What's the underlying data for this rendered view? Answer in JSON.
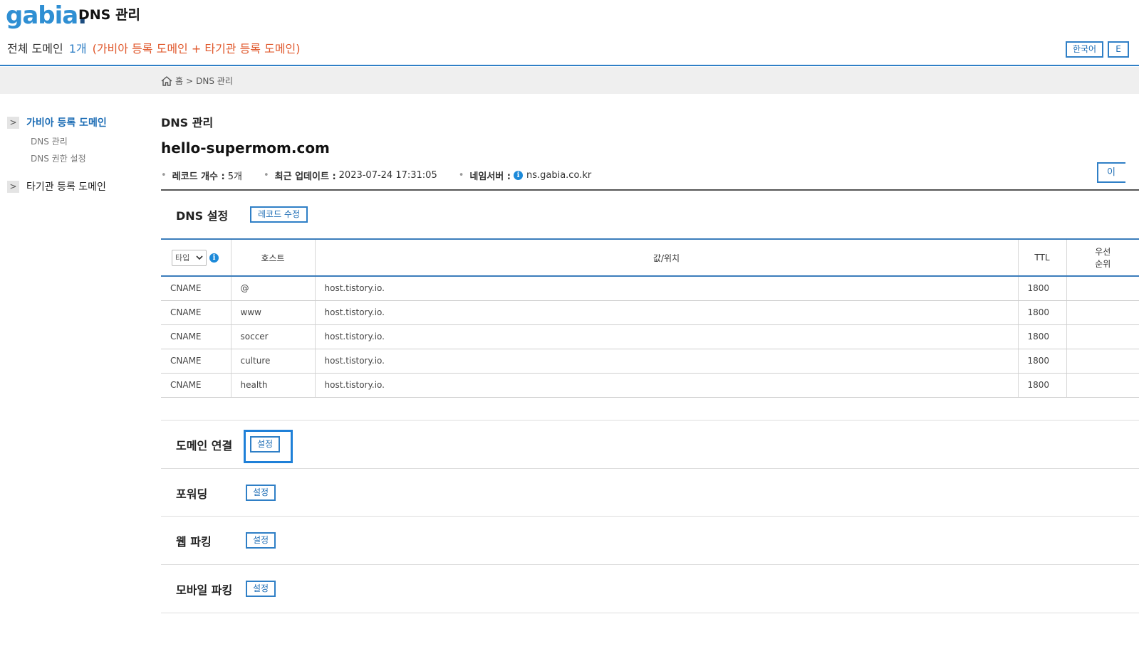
{
  "header": {
    "logo": "gabia",
    "logo_dot": ".",
    "app_title": "DNS 관리",
    "summary_label": "전체 도메인",
    "summary_count": "1개",
    "summary_desc": "(가비아 등록 도메인 + 타기관 등록 도메인)",
    "lang_ko": "한국어",
    "lang_en": "E"
  },
  "breadcrumb": {
    "home": "홈",
    "sep": ">",
    "current": "DNS 관리"
  },
  "sidebar": {
    "groups": [
      {
        "label": "가비아 등록 도메인",
        "expand": ">",
        "subs": [
          "DNS 관리",
          "DNS 권한 설정"
        ]
      },
      {
        "label": "타기관 등록 도메인",
        "expand": ">"
      }
    ]
  },
  "main": {
    "title": "DNS 관리",
    "domain": "hello-supermom.com",
    "meta": {
      "bullet": "•",
      "records_label": "레코드 개수 :",
      "records_value": "5개",
      "updated_label": "최근 업데이트 :",
      "updated_value": "2023-07-24 17:31:05",
      "ns_label": "네임서버 :",
      "ns_value": "ns.gabia.co.kr",
      "info_glyph": "i"
    },
    "right_button": "이",
    "dns_setting_title": "DNS 설정",
    "edit_records_button": "레코드 수정"
  },
  "table": {
    "type_select": "타입",
    "columns": [
      "호스트",
      "값/위치",
      "TTL",
      "우선\n순위"
    ],
    "priority_line1": "우선",
    "priority_line2": "순위",
    "rows": [
      {
        "type": "CNAME",
        "host": "@",
        "value": "host.tistory.io.",
        "ttl": "1800",
        "priority": ""
      },
      {
        "type": "CNAME",
        "host": "www",
        "value": "host.tistory.io.",
        "ttl": "1800",
        "priority": ""
      },
      {
        "type": "CNAME",
        "host": "soccer",
        "value": "host.tistory.io.",
        "ttl": "1800",
        "priority": ""
      },
      {
        "type": "CNAME",
        "host": "culture",
        "value": "host.tistory.io.",
        "ttl": "1800",
        "priority": ""
      },
      {
        "type": "CNAME",
        "host": "health",
        "value": "host.tistory.io.",
        "ttl": "1800",
        "priority": ""
      }
    ]
  },
  "sections": [
    {
      "label": "도메인 연결",
      "button": "설정"
    },
    {
      "label": "포워딩",
      "button": "설정"
    },
    {
      "label": "웹 파킹",
      "button": "설정"
    },
    {
      "label": "모바일 파킹",
      "button": "설정"
    }
  ]
}
